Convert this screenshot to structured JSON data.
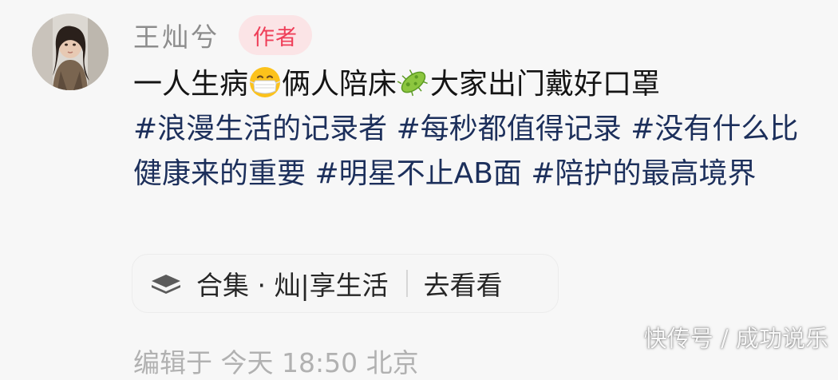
{
  "author": {
    "name": "王灿兮",
    "badge": "作者"
  },
  "post": {
    "text_1": "一人生病",
    "emoji_1": "mask-face-emoji",
    "text_2": "俩人陪床",
    "emoji_2": "microbe-emoji",
    "text_3": "大家出门戴好口罩",
    "tags": "#浪漫生活的记录者 #每秒都值得记录 #没有什么比健康来的重要 #明星不止AB面 #陪护的最高境界"
  },
  "collection": {
    "icon": "layers-icon",
    "label": "合集 · 灿|享生活",
    "action": "去看看"
  },
  "meta_line": "编辑于 今天 18:50 北京",
  "watermark": "快传号 / 成功说乐",
  "colors": {
    "tag_text": "#1c2f5b",
    "badge_text": "#ef3e58",
    "badge_bg": "#fbe4e6",
    "background": "#f7f7f7"
  }
}
